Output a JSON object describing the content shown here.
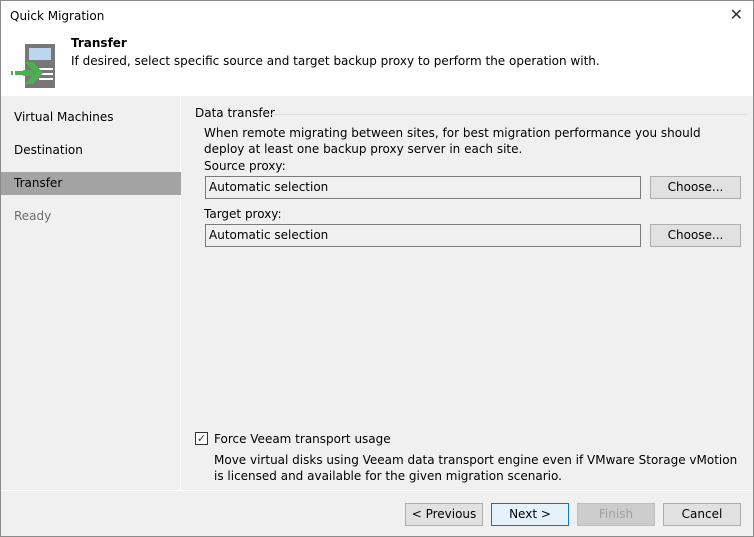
{
  "window": {
    "title": "Quick Migration",
    "close_label": "✕"
  },
  "header": {
    "title": "Transfer",
    "subtitle": "If desired, select specific source and target backup proxy to perform the operation with."
  },
  "nav": {
    "items": [
      {
        "label": "Virtual Machines"
      },
      {
        "label": "Destination"
      },
      {
        "label": "Transfer"
      },
      {
        "label": "Ready"
      }
    ]
  },
  "main": {
    "group_label": "Data transfer",
    "description": "When remote migrating between sites, for best migration performance you should deploy at least one backup proxy server in each site.",
    "source_label": "Source proxy:",
    "source_value": "Automatic selection",
    "target_label": "Target proxy:",
    "target_value": "Automatic selection",
    "choose_label": "Choose...",
    "force_label": "Force Veeam transport usage",
    "force_checked": "✓",
    "force_desc": "Move virtual disks using Veeam data transport engine even if VMware Storage vMotion is licensed and available for the given migration scenario."
  },
  "footer": {
    "previous": "< Previous",
    "next": "Next >",
    "finish": "Finish",
    "cancel": "Cancel"
  }
}
